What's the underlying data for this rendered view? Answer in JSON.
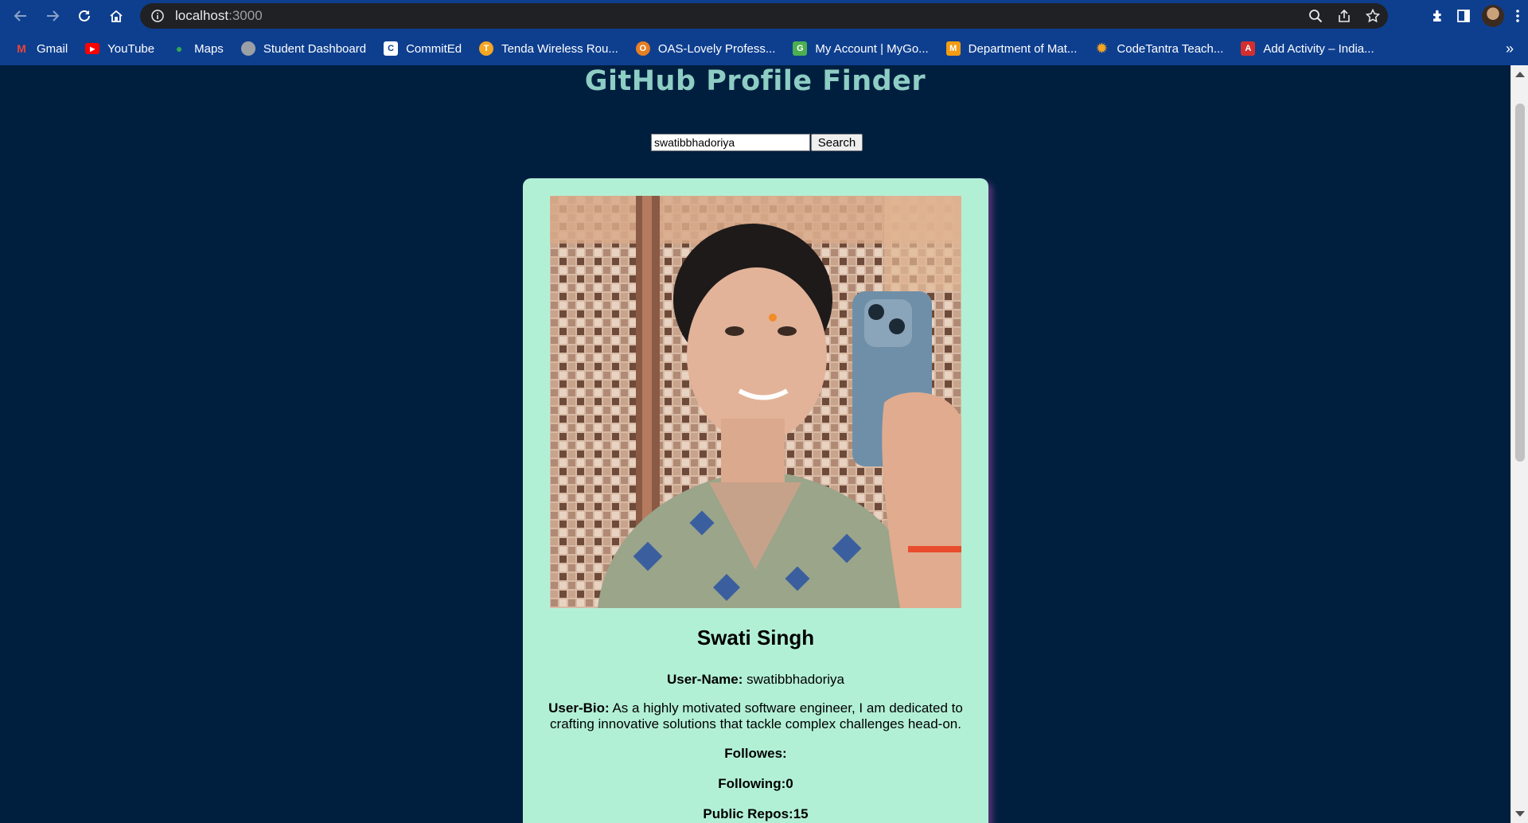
{
  "browser": {
    "url_host": "localhost",
    "url_port": ":3000",
    "bookmarks": [
      {
        "label": "Gmail",
        "icon": "gmail-icon",
        "color": "#ea4335"
      },
      {
        "label": "YouTube",
        "icon": "youtube-icon",
        "color": "#ff0000"
      },
      {
        "label": "Maps",
        "icon": "maps-icon",
        "color": "#34a853"
      },
      {
        "label": "Student Dashboard",
        "icon": "globe-icon",
        "color": "#9aa0a6"
      },
      {
        "label": "CommitEd",
        "icon": "commited-icon",
        "color": "#ffffff"
      },
      {
        "label": "Tenda Wireless Rou...",
        "icon": "tenda-icon",
        "color": "#f5a623"
      },
      {
        "label": "OAS-Lovely Profess...",
        "icon": "oas-icon",
        "color": "#e67e22"
      },
      {
        "label": "My Account | MyGo...",
        "icon": "mygov-icon",
        "color": "#4caf50"
      },
      {
        "label": "Department of Mat...",
        "icon": "department-icon",
        "color": "#f39c12"
      },
      {
        "label": "CodeTantra Teach...",
        "icon": "codetantra-icon",
        "color": "#f5a623"
      },
      {
        "label": "Add Activity – India...",
        "icon": "add-activity-icon",
        "color": "#d32f2f"
      }
    ]
  },
  "page": {
    "title": "GitHub Profile Finder",
    "search": {
      "value": "swatibbhadoriya",
      "button_label": "Search"
    },
    "profile": {
      "name": "Swati Singh",
      "username_label": "User-Name:",
      "username": "swatibbhadoriya",
      "bio_label": "User-Bio:",
      "bio": "As a highly motivated software engineer, I am dedicated to crafting innovative solutions that tackle complex challenges head-on.",
      "followers_label": "Followes:",
      "followers": "",
      "following_label": "Following:",
      "following": "0",
      "repos_label": "Public Repos:",
      "repos": "15"
    }
  },
  "colors": {
    "page_bg": "#001f3f",
    "title": "#8ecdc4",
    "card_bg": "#b2f0d6",
    "chrome": "#0e3f8f"
  }
}
